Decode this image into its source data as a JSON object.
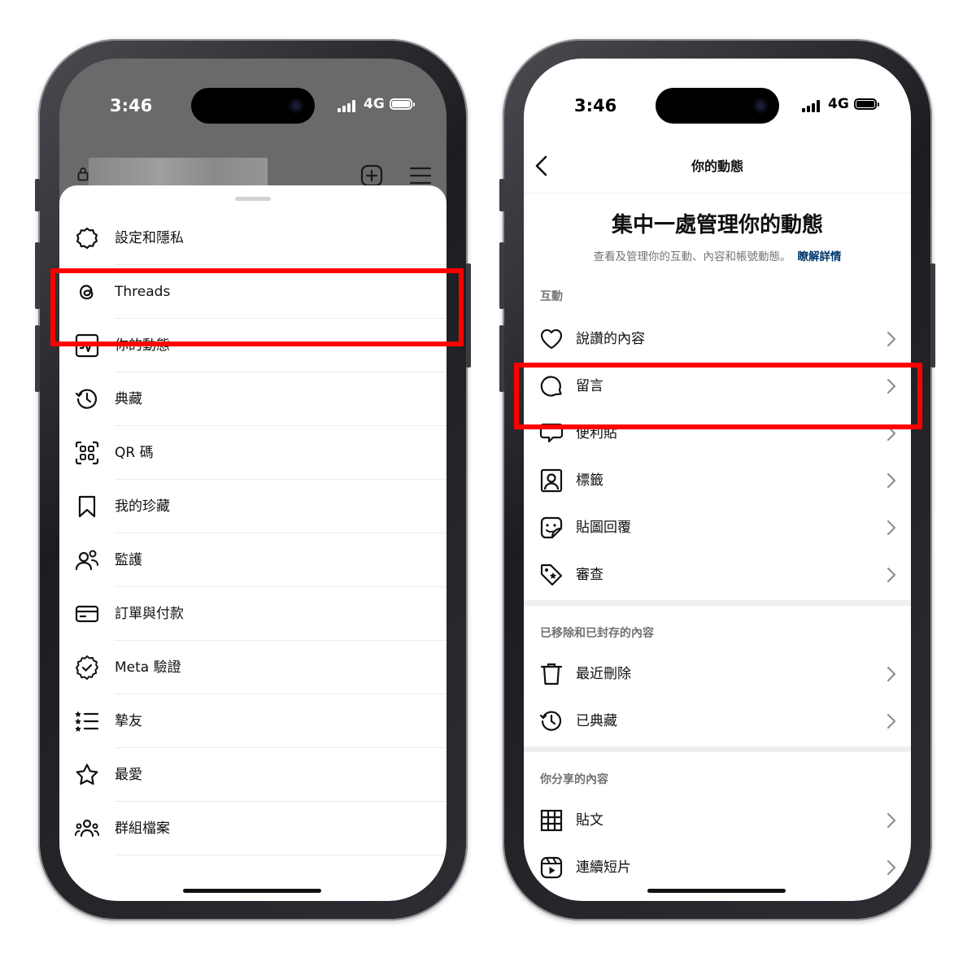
{
  "left_phone": {
    "status": {
      "time": "3:46",
      "network": "4G"
    },
    "menu_items": [
      {
        "label": "設定和隱私",
        "icon": "settings-icon"
      },
      {
        "label": "Threads",
        "icon": "threads-icon"
      },
      {
        "label": "你的動態",
        "icon": "activity-icon"
      },
      {
        "label": "典藏",
        "icon": "archive-icon"
      },
      {
        "label": "QR 碼",
        "icon": "qr-code-icon"
      },
      {
        "label": "我的珍藏",
        "icon": "bookmark-icon"
      },
      {
        "label": "監護",
        "icon": "supervision-icon"
      },
      {
        "label": "訂單與付款",
        "icon": "card-icon"
      },
      {
        "label": "Meta 驗證",
        "icon": "verified-icon"
      },
      {
        "label": "摯友",
        "icon": "close-friends-icon"
      },
      {
        "label": "最愛",
        "icon": "star-icon"
      },
      {
        "label": "群組檔案",
        "icon": "group-icon"
      }
    ]
  },
  "right_phone": {
    "status": {
      "time": "3:46",
      "network": "4G"
    },
    "nav_title": "你的動態",
    "headline": "集中一處管理你的動態",
    "subtitle": "查看及管理你的互動、內容和帳號動態。",
    "learn_more": "瞭解詳情",
    "section_interactions": "互動",
    "interactions": [
      {
        "label": "說讚的內容",
        "icon": "heart-icon"
      },
      {
        "label": "留言",
        "icon": "comment-icon"
      },
      {
        "label": "便利貼",
        "icon": "note-icon"
      },
      {
        "label": "標籤",
        "icon": "tag-person-icon"
      },
      {
        "label": "貼圖回覆",
        "icon": "sticker-icon"
      },
      {
        "label": "審查",
        "icon": "review-tag-icon"
      }
    ],
    "section_removed": "已移除和已封存的內容",
    "removed": [
      {
        "label": "最近刪除",
        "icon": "trash-icon"
      },
      {
        "label": "已典藏",
        "icon": "archive-icon"
      }
    ],
    "section_shared": "你分享的內容",
    "shared": [
      {
        "label": "貼文",
        "icon": "grid-icon"
      },
      {
        "label": "連續短片",
        "icon": "reels-icon"
      }
    ]
  },
  "colors": {
    "highlight": "#ff0000",
    "link": "#00376b",
    "muted": "#737373"
  }
}
